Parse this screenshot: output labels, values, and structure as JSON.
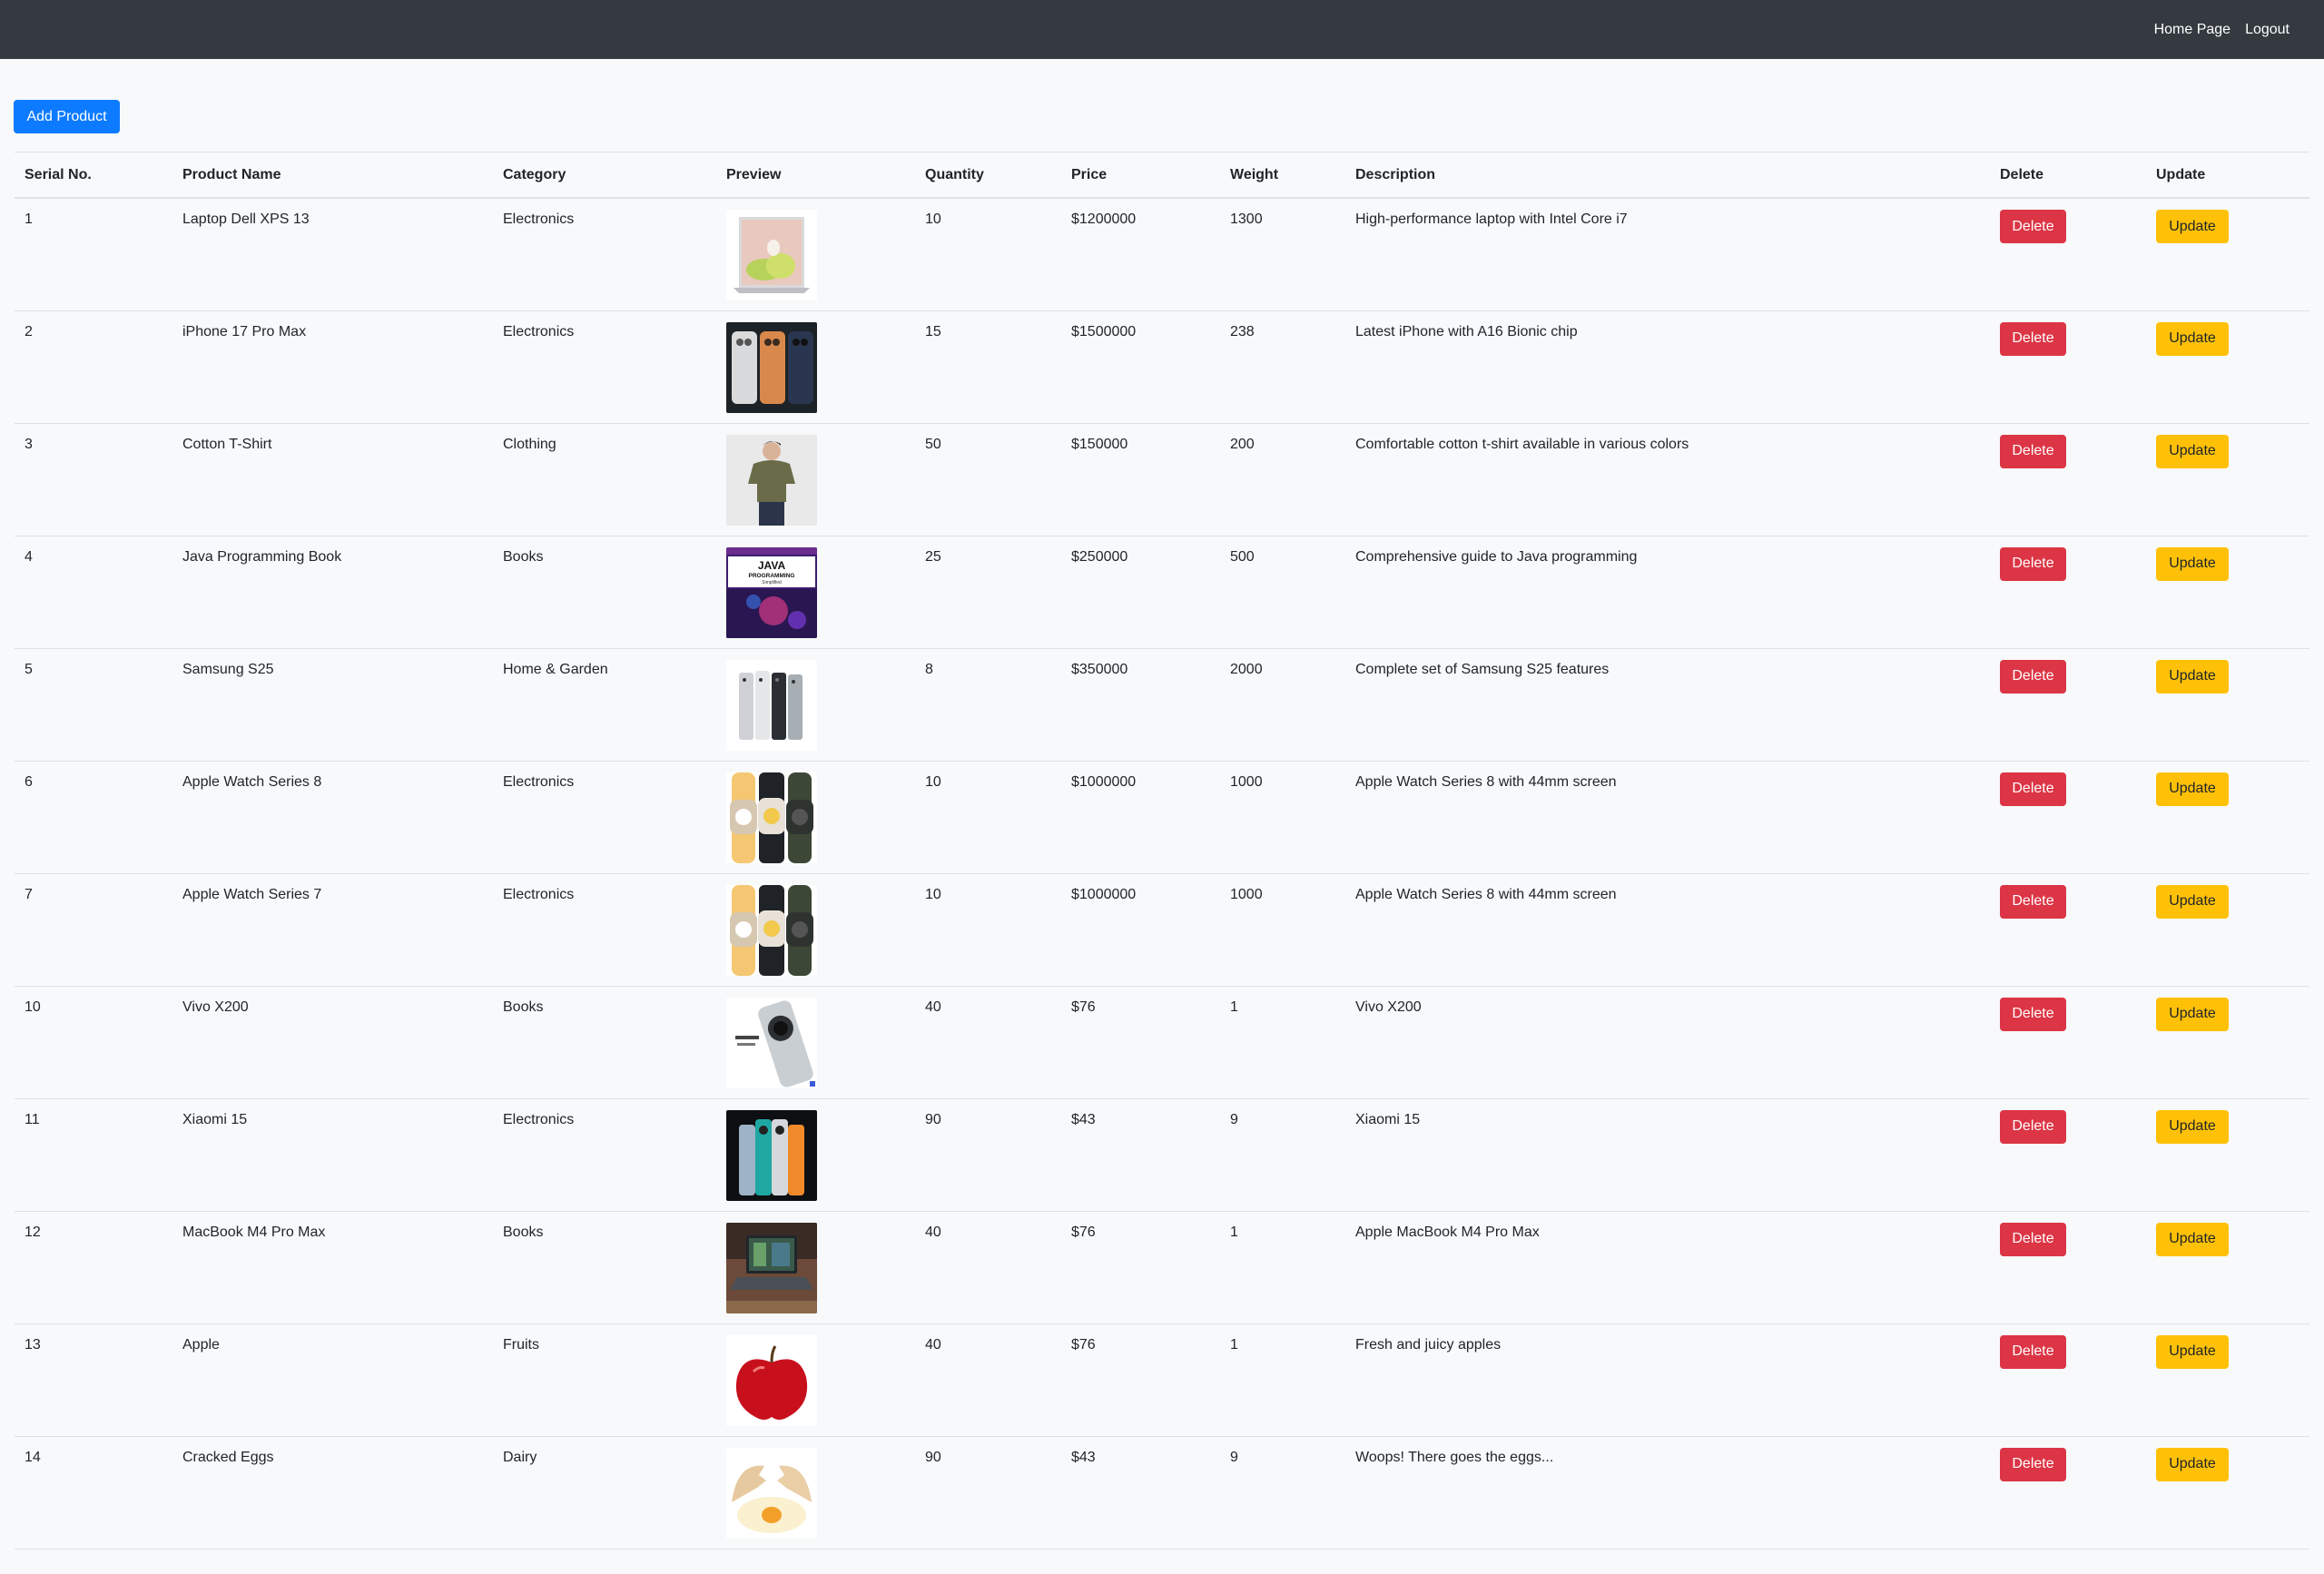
{
  "nav": {
    "home_label": "Home Page",
    "logout_label": "Logout"
  },
  "toolbar": {
    "add_label": "Add Product"
  },
  "table": {
    "headers": {
      "serial": "Serial No.",
      "name": "Product Name",
      "category": "Category",
      "preview": "Preview",
      "quantity": "Quantity",
      "price": "Price",
      "weight": "Weight",
      "description": "Description",
      "delete": "Delete",
      "update": "Update"
    },
    "delete_label": "Delete",
    "update_label": "Update",
    "rows": [
      {
        "serial": "1",
        "name": "Laptop Dell XPS 13",
        "category": "Electronics",
        "image": "laptop-image",
        "quantity": "10",
        "price": "$1200000",
        "weight": "1300",
        "description": "High-performance laptop with Intel Core i7"
      },
      {
        "serial": "2",
        "name": "iPhone 17 Pro Max",
        "category": "Electronics",
        "image": "phones-image",
        "quantity": "15",
        "price": "$1500000",
        "weight": "238",
        "description": "Latest iPhone with A16 Bionic chip"
      },
      {
        "serial": "3",
        "name": "Cotton T-Shirt",
        "category": "Clothing",
        "image": "tshirt-person-image",
        "quantity": "50",
        "price": "$150000",
        "weight": "200",
        "description": "Comfortable cotton t-shirt available in various colors"
      },
      {
        "serial": "4",
        "name": "Java Programming Book",
        "category": "Books",
        "image": "java-book-cover-image",
        "quantity": "25",
        "price": "$250000",
        "weight": "500",
        "description": "Comprehensive guide to Java programming"
      },
      {
        "serial": "5",
        "name": "Samsung S25",
        "category": "Home & Garden",
        "image": "samsung-phones-image",
        "quantity": "8",
        "price": "$350000",
        "weight": "2000",
        "description": "Complete set of Samsung S25 features"
      },
      {
        "serial": "6",
        "name": "Apple Watch Series 8",
        "category": "Electronics",
        "image": "watches-image",
        "quantity": "10",
        "price": "$1000000",
        "weight": "1000",
        "description": "Apple Watch Series 8 with 44mm screen"
      },
      {
        "serial": "7",
        "name": "Apple Watch Series 7",
        "category": "Electronics",
        "image": "watches-image",
        "quantity": "10",
        "price": "$1000000",
        "weight": "1000",
        "description": "Apple Watch Series 8 with 44mm screen"
      },
      {
        "serial": "10",
        "name": "Vivo X200",
        "category": "Books",
        "image": "vivo-phone-image",
        "quantity": "40",
        "price": "$76",
        "weight": "1",
        "description": "Vivo X200"
      },
      {
        "serial": "11",
        "name": "Xiaomi 15",
        "category": "Electronics",
        "image": "xiaomi-phones-image",
        "quantity": "90",
        "price": "$43",
        "weight": "9",
        "description": "Xiaomi 15"
      },
      {
        "serial": "12",
        "name": "MacBook M4 Pro Max",
        "category": "Books",
        "image": "macbook-image",
        "quantity": "40",
        "price": "$76",
        "weight": "1",
        "description": "Apple MacBook M4 Pro Max"
      },
      {
        "serial": "13",
        "name": "Apple",
        "category": "Fruits",
        "image": "red-apple-image",
        "quantity": "40",
        "price": "$76",
        "weight": "1",
        "description": "Fresh and juicy apples"
      },
      {
        "serial": "14",
        "name": "Cracked Eggs",
        "category": "Dairy",
        "image": "cracked-egg-image",
        "quantity": "90",
        "price": "$43",
        "weight": "9",
        "description": "Woops! There goes the eggs..."
      }
    ]
  },
  "book_cover": {
    "title": "JAVA",
    "subtitle": "PROGRAMMING",
    "tagline": "Simplified"
  }
}
